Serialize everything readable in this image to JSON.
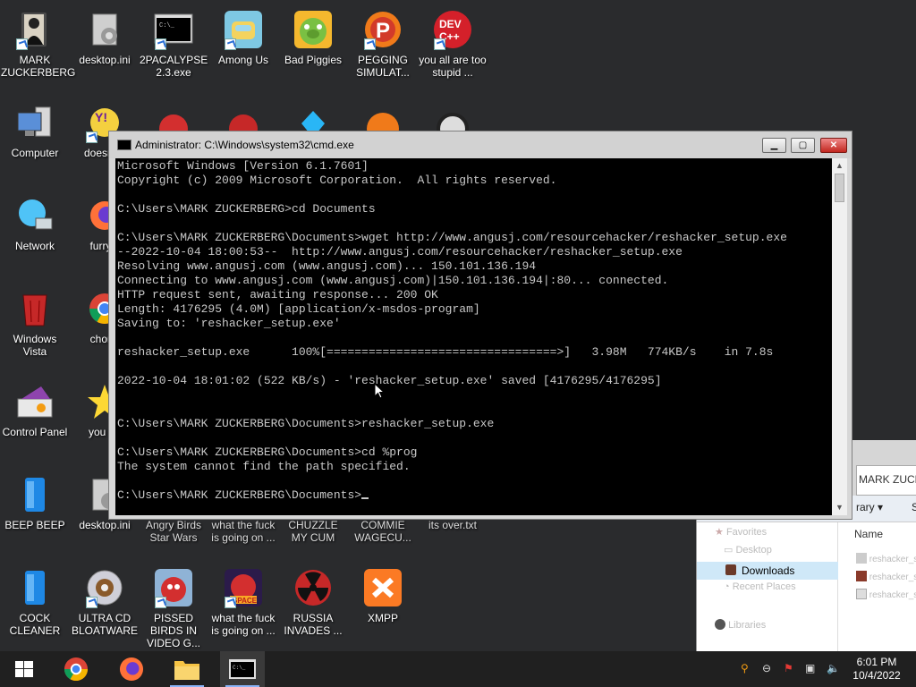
{
  "desktop": {
    "icons": [
      {
        "label": "MARK ZUCKERBERG",
        "icon": "user-folder-icon"
      },
      {
        "label": "desktop.ini",
        "icon": "ini-file-icon"
      },
      {
        "label": "2PACALYPSE 2.3.exe",
        "icon": "console-exe-icon"
      },
      {
        "label": "Among Us",
        "icon": "among-us-icon"
      },
      {
        "label": "Bad Piggies",
        "icon": "bad-piggies-icon"
      },
      {
        "label": "PEGGING SIMULAT...",
        "icon": "pegging-icon"
      },
      {
        "label": "you all are too stupid ...",
        "icon": "dev-cpp-icon"
      },
      {
        "label": "Computer",
        "icon": "computer-icon"
      },
      {
        "label": "doesnt...",
        "icon": "yahoo-icon"
      },
      {
        "label": "Network",
        "icon": "network-icon"
      },
      {
        "label": "furry...",
        "icon": "firefox-icon"
      },
      {
        "label": "Windows Vista",
        "icon": "recycle-bin-icon"
      },
      {
        "label": "chor...",
        "icon": "chrome-icon"
      },
      {
        "label": "Control Panel",
        "icon": "control-panel-icon"
      },
      {
        "label": "you t...",
        "icon": "star-icon"
      },
      {
        "label": "BEEP BEEP",
        "icon": "blue-app-icon"
      },
      {
        "label": "desktop.ini",
        "icon": "ini-file-icon"
      },
      {
        "label": "Angry Birds Star Wars",
        "icon": "angry-birds-icon"
      },
      {
        "label": "what the fuck is going on ...",
        "icon": "angry-birds-icon"
      },
      {
        "label": "CHUZZLE MY CUM",
        "icon": "chuzzle-icon"
      },
      {
        "label": "COMMIE WAGECU...",
        "icon": "commie-icon"
      },
      {
        "label": "its over.txt",
        "icon": "text-file-icon"
      },
      {
        "label": "COCK CLEANER",
        "icon": "blue-app-icon"
      },
      {
        "label": "ULTRA CD BLOATWARE",
        "icon": "cd-icon"
      },
      {
        "label": "PISSED BIRDS IN VIDEO G...",
        "icon": "angry-birds-icon"
      },
      {
        "label": "what the fuck is going on ...",
        "icon": "angry-birds-space-icon"
      },
      {
        "label": "RUSSIA INVADES ...",
        "icon": "radiation-icon"
      },
      {
        "label": "XMPP",
        "icon": "xampp-icon"
      }
    ]
  },
  "cmd_window": {
    "title": "Administrator: C:\\Windows\\system32\\cmd.exe",
    "buttons": {
      "minimize": "▁",
      "maximize": "▢",
      "close": "✕"
    },
    "lines": [
      "Microsoft Windows [Version 6.1.7601]",
      "Copyright (c) 2009 Microsoft Corporation.  All rights reserved.",
      "",
      "C:\\Users\\MARK ZUCKERBERG>cd Documents",
      "",
      "C:\\Users\\MARK ZUCKERBERG\\Documents>wget http://www.angusj.com/resourcehacker/reshacker_setup.exe",
      "--2022-10-04 18:00:53--  http://www.angusj.com/resourcehacker/reshacker_setup.exe",
      "Resolving www.angusj.com (www.angusj.com)... 150.101.136.194",
      "Connecting to www.angusj.com (www.angusj.com)|150.101.136.194|:80... connected.",
      "HTTP request sent, awaiting response... 200 OK",
      "Length: 4176295 (4.0M) [application/x-msdos-program]",
      "Saving to: 'reshacker_setup.exe'",
      "",
      "reshacker_setup.exe      100%[=================================>]   3.98M   774KB/s    in 7.8s",
      "",
      "2022-10-04 18:01:02 (522 KB/s) - 'reshacker_setup.exe' saved [4176295/4176295]",
      "",
      "",
      "C:\\Users\\MARK ZUCKERBERG\\Documents>reshacker_setup.exe",
      "",
      "C:\\Users\\MARK ZUCKERBERG\\Documents>cd %prog",
      "The system cannot find the path specified.",
      "",
      "C:\\Users\\MARK ZUCKERBERG\\Documents>"
    ]
  },
  "explorer_window": {
    "title": "MARK ZUCK",
    "toolbar_item": "rary ▾",
    "toolbar_more": "S",
    "column_header": "Name",
    "nav_items": [
      {
        "label": "Favorites",
        "icon": "star-icon"
      },
      {
        "label": "Desktop",
        "icon": "desktop-icon"
      },
      {
        "label": "Downloads",
        "icon": "downloads-icon",
        "selected": true
      },
      {
        "label": "Recent Places",
        "icon": "recent-icon"
      },
      {
        "label": "Libraries",
        "icon": "library-icon"
      }
    ],
    "files": [
      "reshacker_setup",
      "reshacker_setup",
      "reshacker_setup"
    ]
  },
  "taskbar": {
    "apps": [
      {
        "name": "start-button",
        "icon": "windows-logo-icon"
      },
      {
        "name": "chrome",
        "icon": "chrome-icon"
      },
      {
        "name": "firefox",
        "icon": "firefox-icon"
      },
      {
        "name": "explorer",
        "icon": "folder-icon"
      },
      {
        "name": "cmd",
        "icon": "cmd-icon",
        "active": true
      }
    ],
    "tray": {
      "time": "6:01 PM",
      "date": "10/4/2022"
    }
  },
  "colors": {
    "desktop_bg": "#2a2b2d",
    "taskbar_bg": "#202020",
    "console_bg": "#000000",
    "console_text": "#c8c8c8",
    "selection": "#cde6f7"
  }
}
